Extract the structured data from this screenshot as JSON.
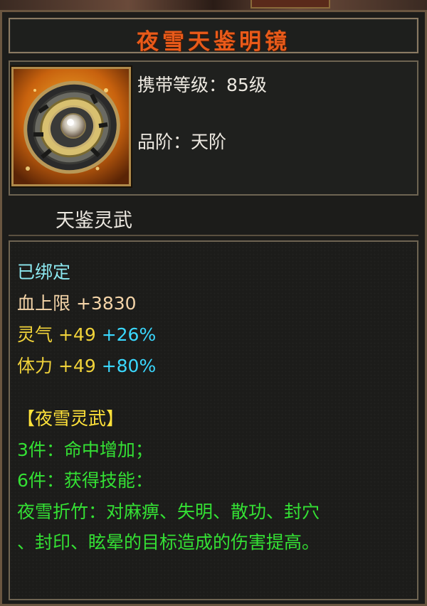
{
  "title": "夜雪天鉴明镜",
  "info": {
    "level_label": "携带等级：",
    "level_value": "85级",
    "grade_label": "品阶：",
    "grade_value": "天阶"
  },
  "subtitle": "天鉴灵武",
  "icon_name": "mirror-shield-item-icon",
  "status": "已绑定",
  "stats": [
    {
      "name": "血上限",
      "value": "+3830"
    },
    {
      "name": "灵气",
      "value": "+49",
      "percent": "+26%"
    },
    {
      "name": "体力",
      "value": "+49",
      "percent": "+80%"
    }
  ],
  "set": {
    "name": "【夜雪灵武】",
    "bonus_3": "3件：命中增加；",
    "bonus_6": "6件：获得技能：",
    "skill_line1": "夜雪折竹：对麻痹、失明、散功、封穴",
    "skill_line2": "、封印、眩晕的目标造成的伤害提高。"
  },
  "colors": {
    "title": "#e85a1a",
    "status": "#8ce8f0",
    "hp_stat": "#f4d4a8",
    "attr_stat": "#f0d23a",
    "percent": "#3ad8ff",
    "set_name": "#ffe23a",
    "set_text": "#34e034"
  }
}
